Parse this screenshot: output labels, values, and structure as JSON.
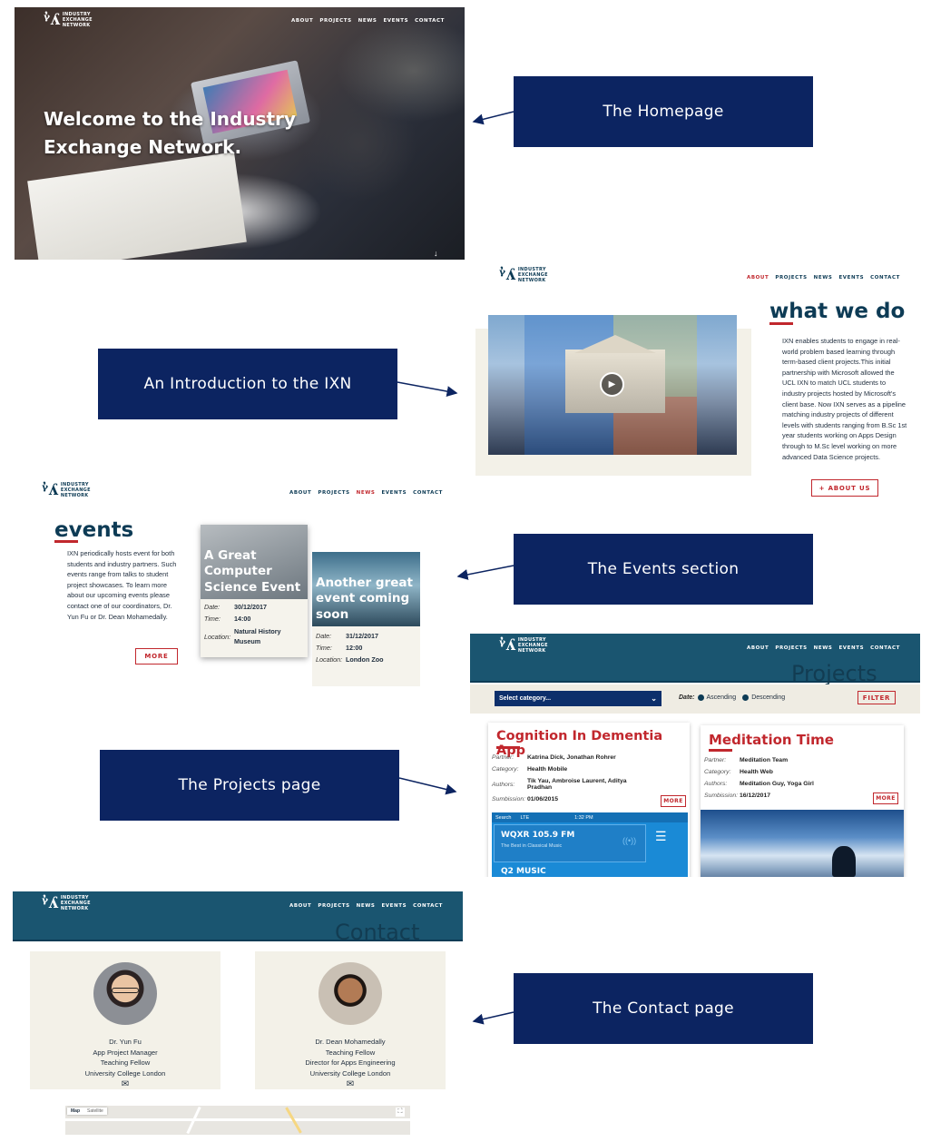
{
  "callouts": {
    "homepage": "The Homepage",
    "intro": "An Introduction to the IXN",
    "events": "The Events section",
    "projects": "The Projects page",
    "contact": "The Contact page"
  },
  "logo": {
    "line1": "INDUSTRY",
    "line2": "EXCHANGE",
    "line3": "NETWORK"
  },
  "nav": {
    "about": "ABOUT",
    "projects": "PROJECTS",
    "news": "NEWS",
    "events": "EVENTS",
    "contact": "CONTACT"
  },
  "homepage": {
    "title_line1": "Welcome to the Industry",
    "title_line2": "Exchange Network."
  },
  "intro": {
    "title": "what we do",
    "body": "IXN enables students to engage in real-world problem based learning through term-based client projects.This initial partnership with Microsoft allowed the UCL IXN to match UCL students to industry projects hosted by Microsoft's client base. Now IXN serves as a pipeline matching industry projects of different levels with students ranging from B.Sc 1st year students working on Apps Design through to M.Sc level working on more advanced Data Science projects.",
    "button": "+ ABOUT US"
  },
  "events": {
    "title": "events",
    "body": "IXN periodically hosts event for both students and industry partners. Such events range from talks to student project showcases. To learn more about our upcoming events please contact one of our coordinators, Dr. Yun Fu or Dr. Dean Mohamedally.",
    "more": "MORE",
    "labels": {
      "date": "Date:",
      "time": "Time:",
      "location": "Location:"
    },
    "cards": [
      {
        "title": "A Great Computer Science Event",
        "date": "30/12/2017",
        "time": "14:00",
        "location": "Natural History Museum"
      },
      {
        "title": "Another great event coming soon",
        "date": "31/12/2017",
        "time": "12:00",
        "location": "London Zoo"
      }
    ]
  },
  "projects": {
    "page_title": "Projects",
    "select_placeholder": "Select category...",
    "date_label": "Date:",
    "ascending": "Ascending",
    "descending": "Descending",
    "filter": "FILTER",
    "labels": {
      "partner": "Partner:",
      "category": "Category:",
      "authors": "Authors:",
      "submission": "Sumbission:"
    },
    "more": "MORE",
    "cards": [
      {
        "title": "Cognition In Dementia App",
        "partner": "Katrina Dick, Jonathan Rohrer",
        "category": "Health Mobile",
        "authors": "Tik Yau, Ambroise Laurent, Aditya Pradhan",
        "submission": "01/06/2015"
      },
      {
        "title": "Meditation Time",
        "partner": "Meditation Team",
        "category": "Health Web",
        "authors": "Meditation Guy, Yoga Girl",
        "submission": "16/12/2017"
      }
    ],
    "phone": {
      "status_left": "Search",
      "status_carrier": "LTE",
      "status_time": "1:32 PM",
      "station": "WQXR 105.9 FM",
      "tagline": "The Best in Classical Music",
      "next_station": "Q2 MUSIC"
    }
  },
  "contact": {
    "page_title": "Contact",
    "people": [
      {
        "name": "Dr. Yun Fu",
        "role1": "App Project Manager",
        "role2": "Teaching Fellow",
        "org": "University College London"
      },
      {
        "name": "Dr. Dean Mohamedally",
        "role1": "Teaching Fellow",
        "role2": "Director for Apps Engineering",
        "org": "University College London"
      }
    ],
    "map_tab1": "Map",
    "map_tab2": "Satellite"
  },
  "colors": {
    "navy_callout": "#0c2461",
    "brand_red": "#c1272d",
    "teal": "#1a5570",
    "ink": "#0d3b55"
  },
  "icons": [
    "arrow-down-icon",
    "play-icon",
    "chevron-down-icon",
    "envelope-icon",
    "broadcast-icon",
    "menu-icon",
    "fullscreen-icon"
  ]
}
